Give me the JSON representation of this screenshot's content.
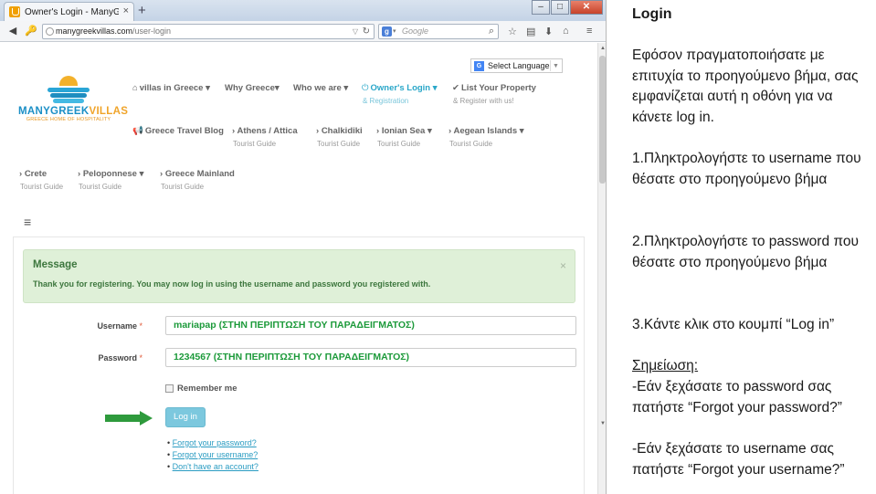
{
  "browser": {
    "tab_title": "Owner's Login - ManyGree...",
    "tab_close": "×",
    "new_tab": "+",
    "url_host": "manygreekvillas.com",
    "url_path": "/user-login",
    "search_placeholder": "Google",
    "window_controls": [
      "–",
      "□",
      "✕"
    ]
  },
  "site": {
    "logo_name_a": "MANYGREEK",
    "logo_name_b": "VILLAS",
    "logo_tagline": "GREECE HOME OF HOSPITALITY",
    "translate_label": "Select Language",
    "menu_row1": [
      {
        "label": "villas in Greece",
        "sub": ""
      },
      {
        "label": "Why Greece",
        "sub": ""
      },
      {
        "label": "Who we are",
        "sub": ""
      },
      {
        "label": "Owner's Login",
        "sub": "& Registration"
      },
      {
        "label": "List Your Property",
        "sub": "& Register with us!"
      }
    ],
    "menu_row2": [
      {
        "label": "Greece Travel Blog",
        "sub": ""
      },
      {
        "label": "Athens / Attica",
        "sub": "Tourist Guide"
      },
      {
        "label": "Chalkidiki",
        "sub": "Tourist Guide"
      },
      {
        "label": "Ionian Sea",
        "sub": "Tourist Guide"
      },
      {
        "label": "Aegean Islands",
        "sub": "Tourist Guide"
      }
    ],
    "menu_row3": [
      {
        "label": "Crete",
        "sub": "Tourist Guide"
      },
      {
        "label": "Peloponnese",
        "sub": "Tourist Guide"
      },
      {
        "label": "Greece Mainland",
        "sub": "Tourist Guide"
      }
    ]
  },
  "message": {
    "title": "Message",
    "text": "Thank you for registering. You may now log in using the username and password you registered with.",
    "close": "×"
  },
  "form": {
    "username_label": "Username",
    "username_value": "mariapap (ΣΤΗΝ ΠΕΡΙΠΤΩΣΗ ΤΟΥ ΠΑΡΑΔΕΙΓΜΑΤΟΣ)",
    "password_label": "Password",
    "password_value": "1234567 (ΣΤΗΝ ΠΕΡΙΠΤΩΣΗ ΤΟΥ ΠΑΡΑΔΕΙΓΜΑΤΟΣ)",
    "required_mark": "*",
    "remember_label": "Remember me",
    "login_button": "Log in",
    "links": [
      "Forgot your password?",
      "Forgot your username?",
      "Don't have an account?"
    ]
  },
  "instructions": {
    "heading": "Login",
    "intro": "Εφόσον πραγματοποιήσατε με επιτυχία το προηγούμενο βήμα, σας εμφανίζεται αυτή η οθόνη για να κάνετε log in.",
    "step1": "1.Πληκτρολογήστε το username που θέσατε στο προηγούμενο βήμα",
    "step2": "2.Πληκτρολογήστε το password που θέσατε στο προηγούμενο βήμα",
    "step3": "3.Κάντε κλικ στο κουμπί “Log in”",
    "note_title": "Σημείωση:",
    "note1": "-Εάν ξεχάσατε το password σας πατήστε “Forgot your password?”",
    "note2": "-Εάν ξεχάσατε το username σας πατήστε “Forgot your username?”"
  },
  "colors": {
    "accent": "#2aa7c9",
    "success_bg": "#dff0d8",
    "success_text": "#3c763d",
    "input_text": "#1c9a3a",
    "arrow": "#2e9a3c"
  }
}
